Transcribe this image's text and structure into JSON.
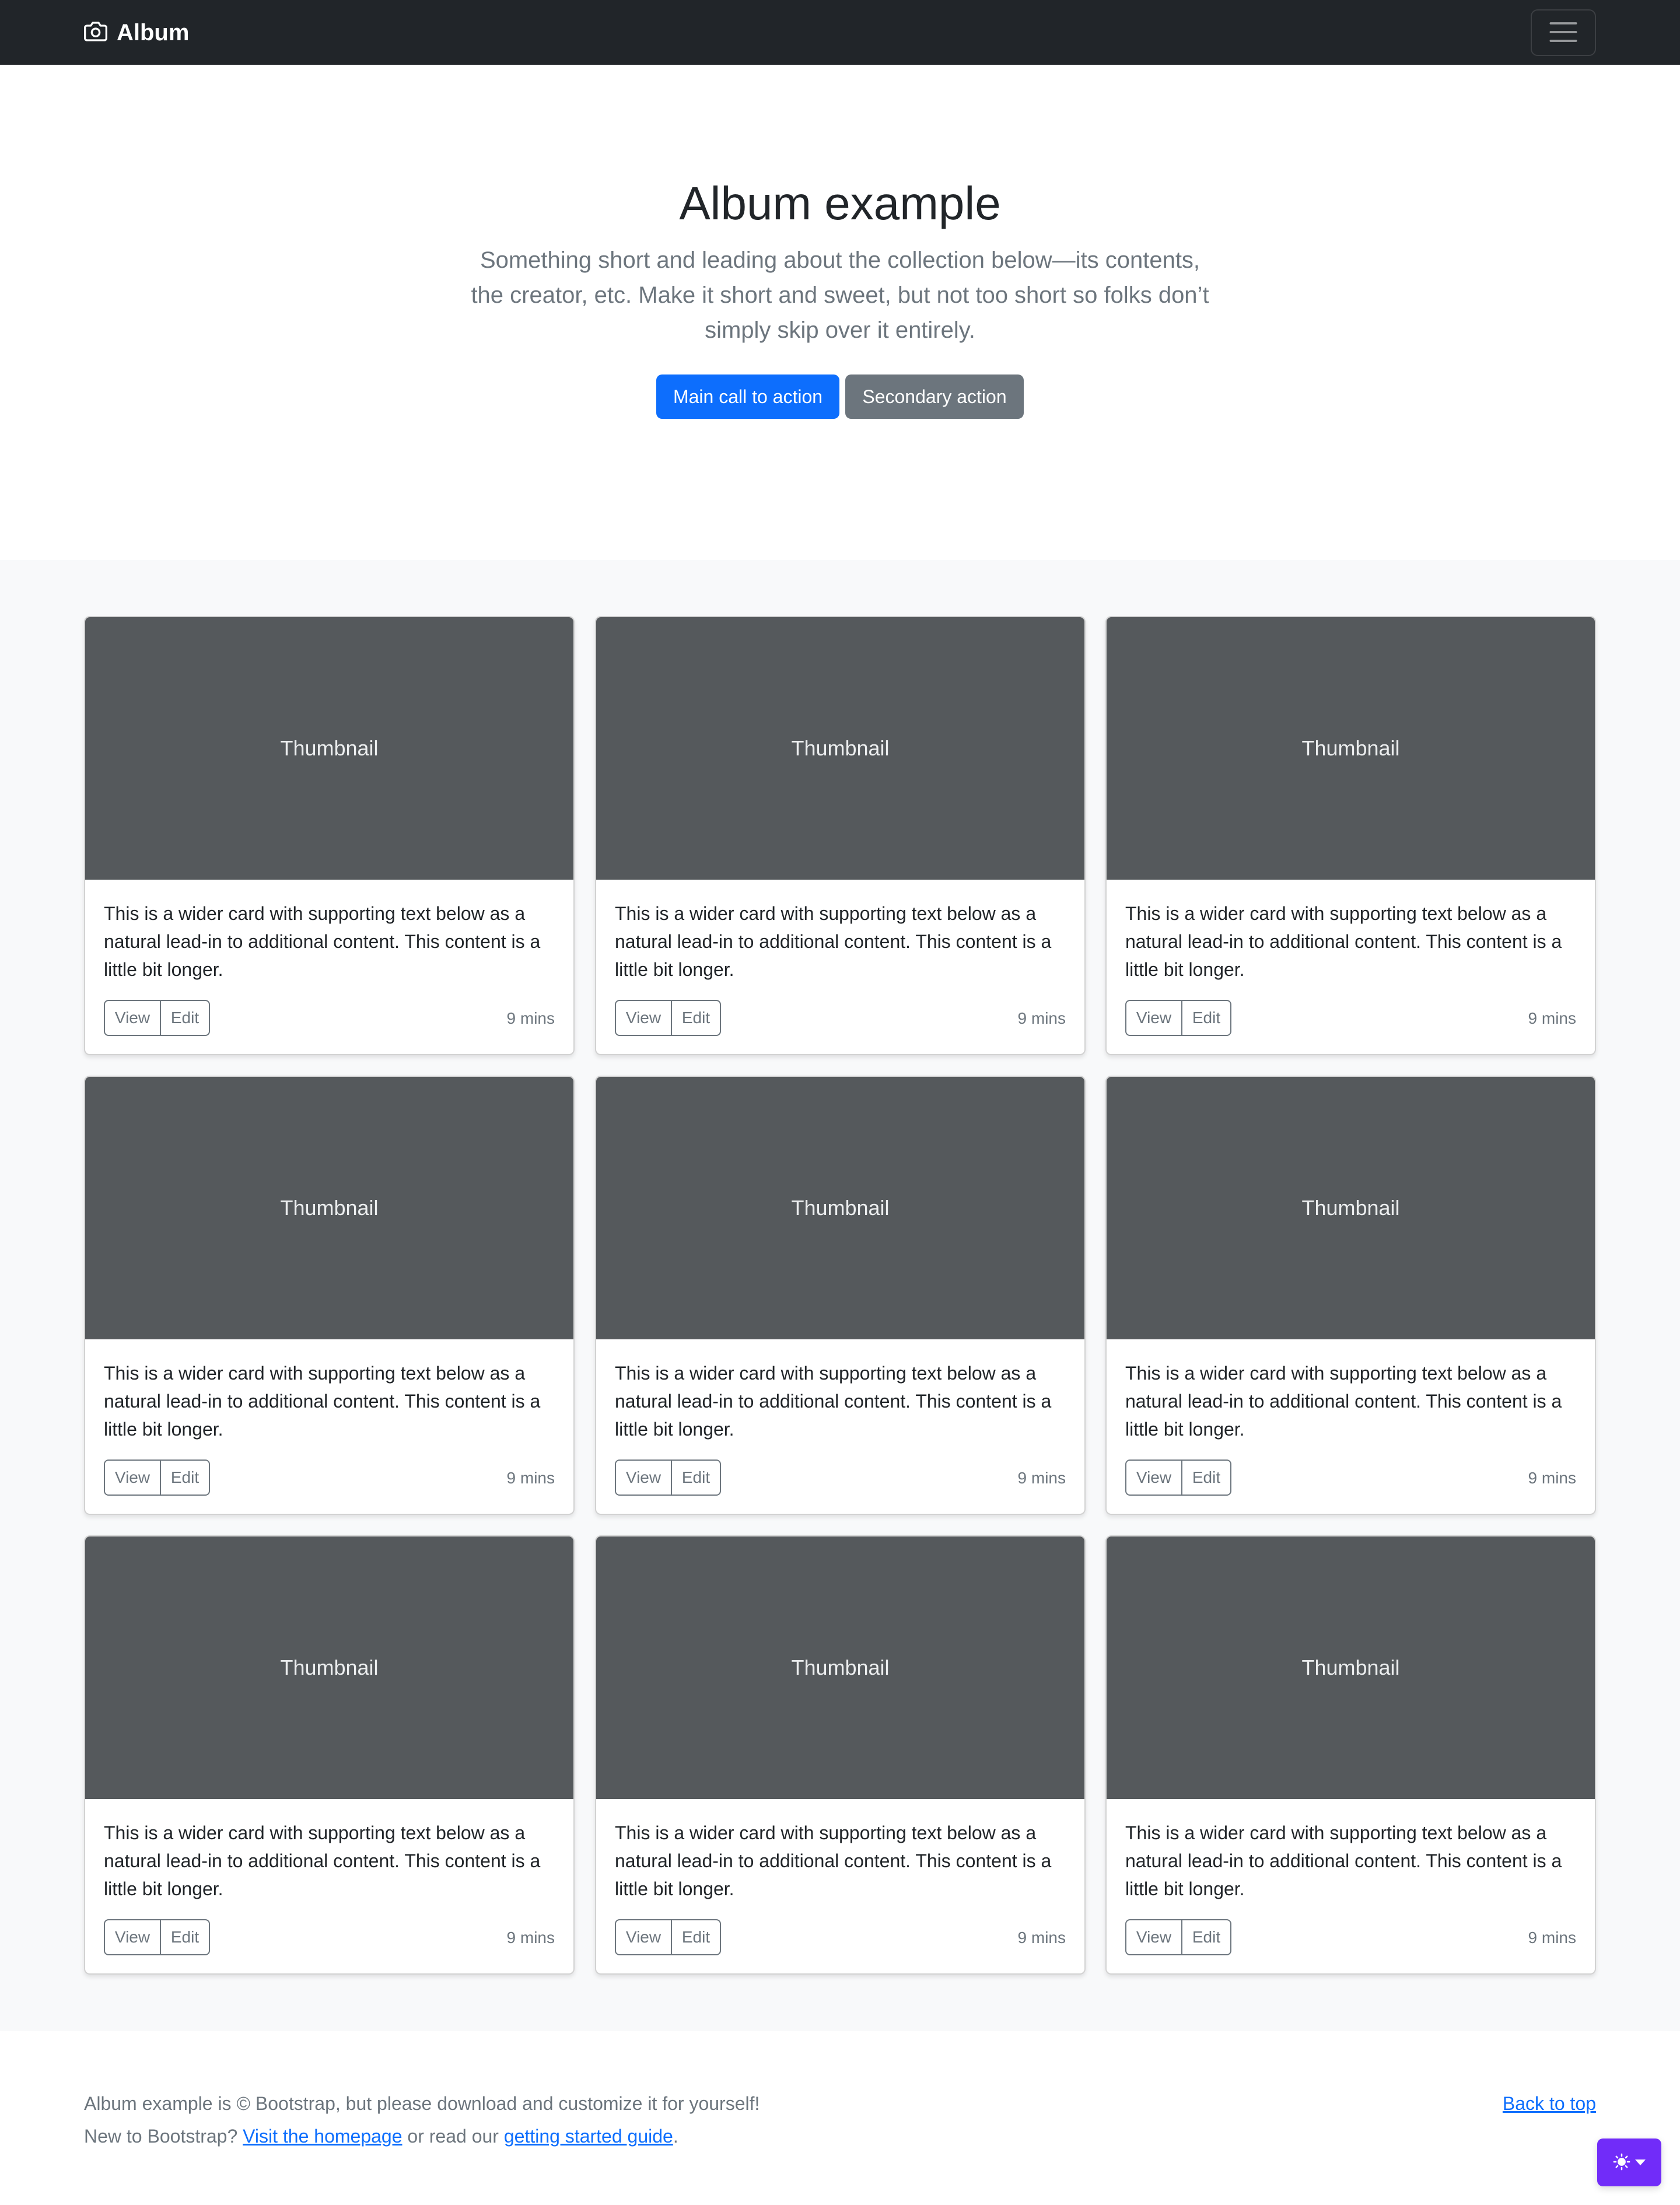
{
  "navbar": {
    "brand": "Album",
    "brand_icon": "camera-icon",
    "toggler_icon": "hamburger-menu-icon"
  },
  "hero": {
    "title": "Album example",
    "lead": "Something short and leading about the collection below—its contents, the creator, etc. Make it short and sweet, but not too short so folks don’t simply skip over it entirely.",
    "primary_button": "Main call to action",
    "secondary_button": "Secondary action"
  },
  "cards": [
    {
      "thumb": "Thumbnail",
      "text": "This is a wider card with supporting text below as a natural lead-in to additional content. This content is a little bit longer.",
      "view": "View",
      "edit": "Edit",
      "time": "9 mins"
    },
    {
      "thumb": "Thumbnail",
      "text": "This is a wider card with supporting text below as a natural lead-in to additional content. This content is a little bit longer.",
      "view": "View",
      "edit": "Edit",
      "time": "9 mins"
    },
    {
      "thumb": "Thumbnail",
      "text": "This is a wider card with supporting text below as a natural lead-in to additional content. This content is a little bit longer.",
      "view": "View",
      "edit": "Edit",
      "time": "9 mins"
    },
    {
      "thumb": "Thumbnail",
      "text": "This is a wider card with supporting text below as a natural lead-in to additional content. This content is a little bit longer.",
      "view": "View",
      "edit": "Edit",
      "time": "9 mins"
    },
    {
      "thumb": "Thumbnail",
      "text": "This is a wider card with supporting text below as a natural lead-in to additional content. This content is a little bit longer.",
      "view": "View",
      "edit": "Edit",
      "time": "9 mins"
    },
    {
      "thumb": "Thumbnail",
      "text": "This is a wider card with supporting text below as a natural lead-in to additional content. This content is a little bit longer.",
      "view": "View",
      "edit": "Edit",
      "time": "9 mins"
    },
    {
      "thumb": "Thumbnail",
      "text": "This is a wider card with supporting text below as a natural lead-in to additional content. This content is a little bit longer.",
      "view": "View",
      "edit": "Edit",
      "time": "9 mins"
    },
    {
      "thumb": "Thumbnail",
      "text": "This is a wider card with supporting text below as a natural lead-in to additional content. This content is a little bit longer.",
      "view": "View",
      "edit": "Edit",
      "time": "9 mins"
    },
    {
      "thumb": "Thumbnail",
      "text": "This is a wider card with supporting text below as a natural lead-in to additional content. This content is a little bit longer.",
      "view": "View",
      "edit": "Edit",
      "time": "9 mins"
    }
  ],
  "footer": {
    "line1": "Album example is © Bootstrap, but please download and customize it for yourself!",
    "line2_prefix": "New to Bootstrap? ",
    "homepage_link": "Visit the homepage",
    "line2_middle": " or read our ",
    "guide_link": "getting started guide",
    "line2_suffix": ".",
    "back_to_top": "Back to top"
  },
  "theme_toggle": {
    "icon": "sun-icon",
    "accent": "#712cf9"
  },
  "colors": {
    "navbar_bg": "#212529",
    "primary": "#0d6efd",
    "secondary": "#6c757d",
    "thumbnail_bg": "#55595c",
    "album_bg": "#f8f9fa"
  }
}
